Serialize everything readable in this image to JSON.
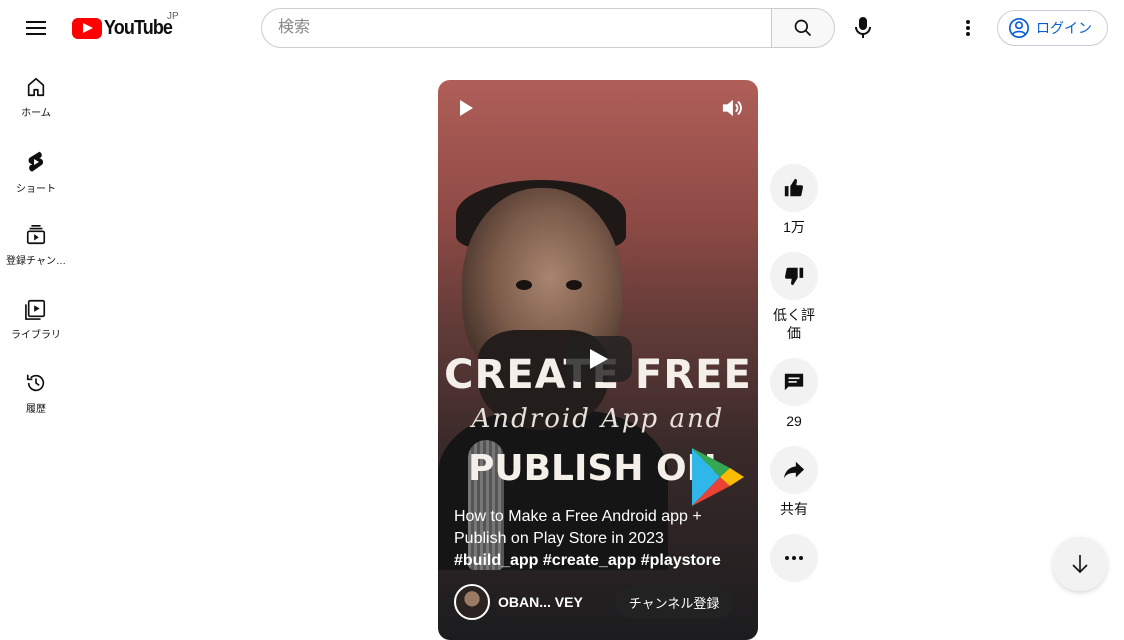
{
  "header": {
    "logo_text": "YouTube",
    "region": "JP",
    "search_placeholder": "検索",
    "login_label": "ログイン"
  },
  "sidebar": {
    "items": [
      {
        "label": "ホーム",
        "icon": "home-icon"
      },
      {
        "label": "ショート",
        "icon": "shorts-icon"
      },
      {
        "label": "登録チャン…",
        "icon": "subscriptions-icon"
      },
      {
        "label": "ライブラリ",
        "icon": "library-icon"
      },
      {
        "label": "履歴",
        "icon": "history-icon"
      }
    ]
  },
  "video": {
    "overlay_title_line1": "CREATE FREE",
    "overlay_title_line2": "Android App and",
    "overlay_title_line3": "PUBLISH ON",
    "caption": "How to Make a Free Android app + Publish on Play Store in 2023",
    "hashtags": "#build_app #create_app #playstore",
    "channel_name": "OBAN... VEY",
    "subscribe_label": "チャンネル登録"
  },
  "actions": {
    "like_count": "1万",
    "dislike_label": "低く評価",
    "comment_count": "29",
    "share_label": "共有"
  },
  "colors": {
    "brand_red": "#ff0000",
    "link_blue": "#065fd4"
  }
}
